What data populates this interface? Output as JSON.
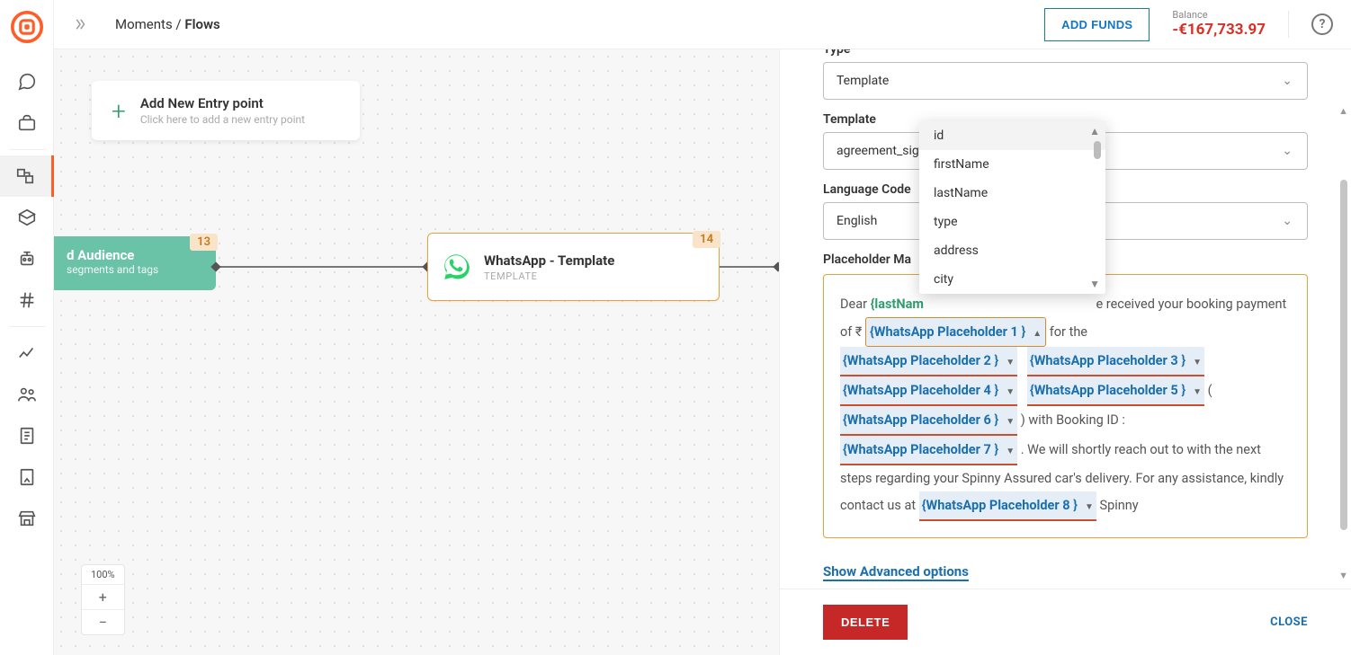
{
  "topbar": {
    "breadcrumb_root": "Moments",
    "breadcrumb_sep": " / ",
    "breadcrumb_current": "Flows",
    "add_funds": "ADD FUNDS",
    "balance_label": "Balance",
    "balance_value": "-€167,733.97"
  },
  "canvas": {
    "entry_title": "Add New Entry point",
    "entry_sub": "Click here to add a new entry point",
    "audience_title": "d Audience",
    "audience_sub": "segments and tags",
    "audience_badge": "13",
    "wa_title": "WhatsApp - Template",
    "wa_sub": "TEMPLATE",
    "wa_badge": "14",
    "zoom_pct": "100%",
    "zoom_plus": "+",
    "zoom_minus": "−"
  },
  "panel": {
    "type_label": "Type",
    "type_value": "Template",
    "template_label": "Template",
    "template_value": "agreement_sig",
    "lang_label": "Language Code",
    "lang_value": "English",
    "mapping_label": "Placeholder Ma",
    "dropdown": {
      "items": [
        "id",
        "firstName",
        "lastName",
        "type",
        "address",
        "city"
      ]
    },
    "msg": {
      "t1": "Dear ",
      "ph_lastname": "{lastNam",
      "t2": "e received your booking payment of ₹ ",
      "ph1": "{WhatsApp Placeholder 1 }",
      "t3": " for the",
      "ph2": "{WhatsApp Placeholder 2 }",
      "ph3": "{WhatsApp Placeholder 3 }",
      "ph4": "{WhatsApp Placeholder 4 }",
      "ph5": "{WhatsApp Placeholder 5 }",
      "t4": " (",
      "ph6": "{WhatsApp Placeholder 6 }",
      "t5": ") with Booking ID : ",
      "ph7": "{WhatsApp Placeholder 7 }",
      "t6": ". We will shortly reach out to with the next steps regarding your Spinny Assured car's delivery. For any assistance, kindly contact us at ",
      "ph8": "{WhatsApp Placeholder 8 }",
      "t7": " Spinny"
    },
    "adv_link": "Show Advanced options",
    "delete_btn": "DELETE",
    "close_btn": "CLOSE"
  }
}
